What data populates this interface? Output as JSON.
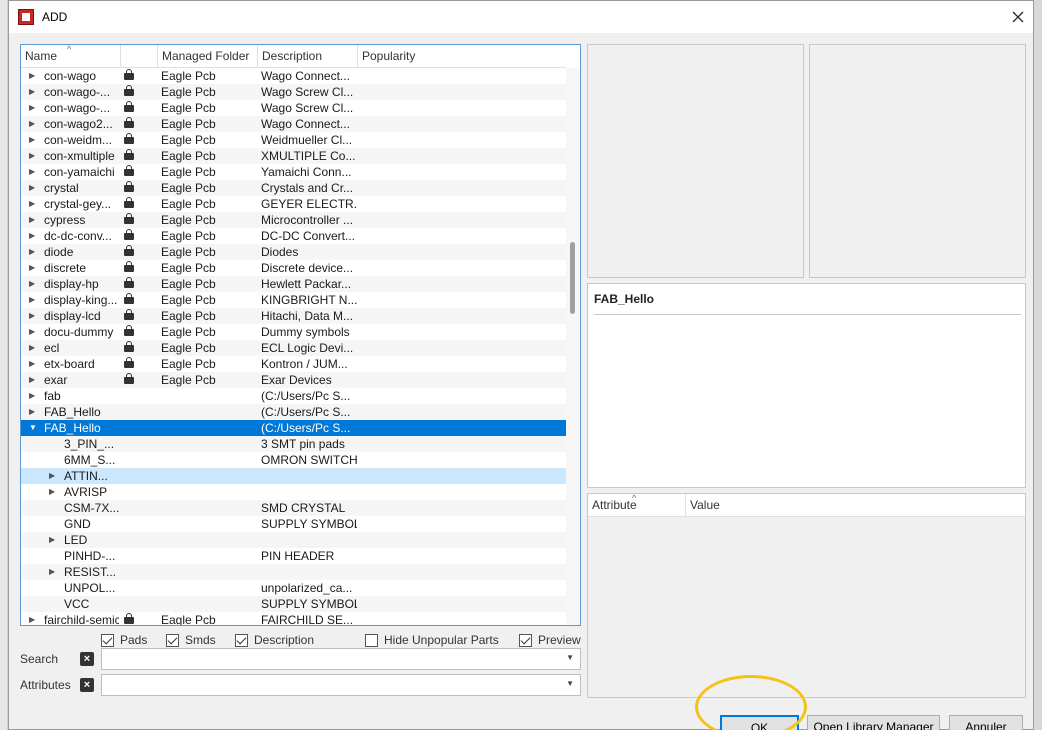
{
  "window": {
    "title": "ADD"
  },
  "tree": {
    "columns": {
      "name": "Name",
      "folder": "Managed Folder",
      "description": "Description",
      "popularity": "Popularity"
    },
    "rows": [
      {
        "arrow": "▶",
        "name": "con-wago",
        "lock": true,
        "folder": "Eagle Pcb",
        "desc": "Wago Connect..."
      },
      {
        "arrow": "▶",
        "name": "con-wago-...",
        "lock": true,
        "folder": "Eagle Pcb",
        "desc": "Wago Screw Cl..."
      },
      {
        "arrow": "▶",
        "name": "con-wago-...",
        "lock": true,
        "folder": "Eagle Pcb",
        "desc": "Wago Screw Cl..."
      },
      {
        "arrow": "▶",
        "name": "con-wago2...",
        "lock": true,
        "folder": "Eagle Pcb",
        "desc": "Wago Connect..."
      },
      {
        "arrow": "▶",
        "name": "con-weidm...",
        "lock": true,
        "folder": "Eagle Pcb",
        "desc": "Weidmueller Cl..."
      },
      {
        "arrow": "▶",
        "name": "con-xmultiple",
        "lock": true,
        "folder": "Eagle Pcb",
        "desc": "XMULTIPLE Co..."
      },
      {
        "arrow": "▶",
        "name": "con-yamaichi",
        "lock": true,
        "folder": "Eagle Pcb",
        "desc": "Yamaichi Conn..."
      },
      {
        "arrow": "▶",
        "name": "crystal",
        "lock": true,
        "folder": "Eagle Pcb",
        "desc": "Crystals and Cr..."
      },
      {
        "arrow": "▶",
        "name": "crystal-gey...",
        "lock": true,
        "folder": "Eagle Pcb",
        "desc": "GEYER ELECTR..."
      },
      {
        "arrow": "▶",
        "name": "cypress",
        "lock": true,
        "folder": "Eagle Pcb",
        "desc": "Microcontroller ..."
      },
      {
        "arrow": "▶",
        "name": "dc-dc-conv...",
        "lock": true,
        "folder": "Eagle Pcb",
        "desc": "DC-DC Convert..."
      },
      {
        "arrow": "▶",
        "name": "diode",
        "lock": true,
        "folder": "Eagle Pcb",
        "desc": "Diodes"
      },
      {
        "arrow": "▶",
        "name": "discrete",
        "lock": true,
        "folder": "Eagle Pcb",
        "desc": "Discrete device..."
      },
      {
        "arrow": "▶",
        "name": "display-hp",
        "lock": true,
        "folder": "Eagle Pcb",
        "desc": "Hewlett Packar..."
      },
      {
        "arrow": "▶",
        "name": "display-king...",
        "lock": true,
        "folder": "Eagle Pcb",
        "desc": "KINGBRIGHT N..."
      },
      {
        "arrow": "▶",
        "name": "display-lcd",
        "lock": true,
        "folder": "Eagle Pcb",
        "desc": "Hitachi, Data M..."
      },
      {
        "arrow": "▶",
        "name": "docu-dummy",
        "lock": true,
        "folder": "Eagle Pcb",
        "desc": "Dummy symbols"
      },
      {
        "arrow": "▶",
        "name": "ecl",
        "lock": true,
        "folder": "Eagle Pcb",
        "desc": "ECL Logic Devi..."
      },
      {
        "arrow": "▶",
        "name": "etx-board",
        "lock": true,
        "folder": "Eagle Pcb",
        "desc": "Kontron / JUM..."
      },
      {
        "arrow": "▶",
        "name": "exar",
        "lock": true,
        "folder": "Eagle Pcb",
        "desc": "Exar Devices"
      },
      {
        "arrow": "▶",
        "name": "fab",
        "lock": false,
        "folder": "",
        "desc": "(C:/Users/Pc S..."
      },
      {
        "arrow": "▶",
        "name": "FAB_Hello",
        "lock": false,
        "folder": "",
        "desc": "(C:/Users/Pc S..."
      },
      {
        "arrow": "▼",
        "name": "FAB_Hello",
        "lock": false,
        "folder": "",
        "desc": "(C:/Users/Pc S...",
        "selected": true
      },
      {
        "arrow": "",
        "name": "3_PIN_...",
        "lock": false,
        "folder": "",
        "desc": "3 SMT pin pads",
        "child": true
      },
      {
        "arrow": "",
        "name": "6MM_S...",
        "lock": false,
        "folder": "",
        "desc": "OMRON SWITCH",
        "child": true
      },
      {
        "arrow": "▶",
        "name": "ATTIN...",
        "lock": false,
        "folder": "",
        "desc": "",
        "child": true,
        "hover": true
      },
      {
        "arrow": "▶",
        "name": "AVRISP",
        "lock": false,
        "folder": "",
        "desc": "",
        "child": true
      },
      {
        "arrow": "",
        "name": "CSM-7X...",
        "lock": false,
        "folder": "",
        "desc": "SMD CRYSTAL",
        "child": true
      },
      {
        "arrow": "",
        "name": "GND",
        "lock": false,
        "folder": "",
        "desc": "SUPPLY SYMBOL",
        "child": true
      },
      {
        "arrow": "▶",
        "name": "LED",
        "lock": false,
        "folder": "",
        "desc": "",
        "child": true
      },
      {
        "arrow": "",
        "name": "PINHD-...",
        "lock": false,
        "folder": "",
        "desc": "PIN HEADER",
        "child": true
      },
      {
        "arrow": "▶",
        "name": "RESIST...",
        "lock": false,
        "folder": "",
        "desc": "",
        "child": true
      },
      {
        "arrow": "",
        "name": "UNPOL...",
        "lock": false,
        "folder": "",
        "desc": "unpolarized_ca...",
        "child": true
      },
      {
        "arrow": "",
        "name": "VCC",
        "lock": false,
        "folder": "",
        "desc": "SUPPLY SYMBOL",
        "child": true
      },
      {
        "arrow": "▶",
        "name": "fairchild-semic",
        "lock": true,
        "folder": "Eagle Pcb",
        "desc": "FAIRCHILD SE..."
      }
    ]
  },
  "options": {
    "pads": {
      "label": "Pads",
      "checked": true
    },
    "smds": {
      "label": "Smds",
      "checked": true
    },
    "description": {
      "label": "Description",
      "checked": true
    },
    "hide_unpopular": {
      "label": "Hide Unpopular Parts",
      "checked": false
    },
    "preview": {
      "label": "Preview",
      "checked": true
    }
  },
  "search": {
    "label": "Search",
    "value": ""
  },
  "attributes": {
    "label": "Attributes",
    "value": ""
  },
  "info": {
    "title": "FAB_Hello"
  },
  "attr_table": {
    "col_attribute": "Attribute",
    "col_value": "Value"
  },
  "buttons": {
    "ok": "OK",
    "open_library_manager": "Open Library Manager",
    "cancel": "Annuler"
  }
}
